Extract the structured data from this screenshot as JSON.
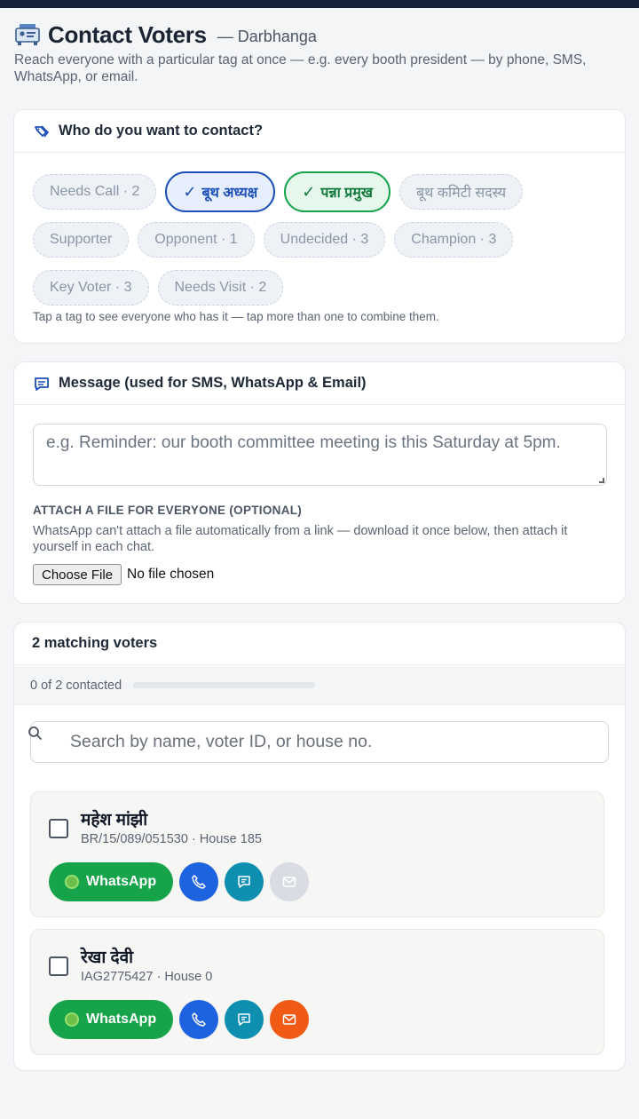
{
  "header": {
    "title": "Contact Voters",
    "subtitle": "— Darbhanga",
    "description": "Reach everyone with a particular tag at once — e.g. every booth president — by phone, SMS, WhatsApp, or email."
  },
  "tags_card": {
    "heading": "Who do you want to contact?",
    "tags": [
      {
        "label": "Needs Call · 2",
        "selected": false
      },
      {
        "label": "बूथ अध्यक्ष",
        "selected": true
      },
      {
        "label": "पन्ना प्रमुख",
        "selected": true
      },
      {
        "label": "बूथ कमिटी सदस्य",
        "selected": false
      },
      {
        "label": "Supporter",
        "selected": false
      },
      {
        "label": "Opponent · 1",
        "selected": false
      },
      {
        "label": "Undecided · 3",
        "selected": false
      },
      {
        "label": "Champion · 3",
        "selected": false
      },
      {
        "label": "Key Voter · 3",
        "selected": false
      },
      {
        "label": "Needs Visit · 2",
        "selected": false
      }
    ],
    "check_glyph": "✓",
    "hint": "Tap a tag to see everyone who has it — tap more than one to combine them."
  },
  "message_card": {
    "heading": "Message (used for SMS, WhatsApp & Email)",
    "placeholder": "e.g. Reminder: our booth committee meeting is this Saturday at 5pm.",
    "attach_label": "ATTACH A FILE FOR EVERYONE (OPTIONAL)",
    "attach_desc": "WhatsApp can't attach a file automatically from a link — download it once below, then attach it yourself in each chat.",
    "file_button": "Choose File",
    "file_status": "No file chosen"
  },
  "voters_card": {
    "heading": "2 matching voters",
    "progress_text": "0 of 2 contacted",
    "progress_fraction": 0,
    "search_placeholder": "Search by name, voter ID, or house no.",
    "whatsapp_label": "WhatsApp",
    "voters": [
      {
        "name": "महेश मांझी",
        "meta": "BR/15/089/051530 · House 185",
        "email_available": false
      },
      {
        "name": "रेखा देवी",
        "meta": "IAG2775427 · House 0",
        "email_available": true
      }
    ]
  },
  "colors": {
    "selected_blue": "#1d4fb8",
    "selected_green": "#16a34a",
    "whatsapp": "#16a34a",
    "phone": "#1d63e0",
    "sms": "#0e8fb0",
    "email": "#f05a14",
    "email_disabled": "#d9dde3"
  }
}
